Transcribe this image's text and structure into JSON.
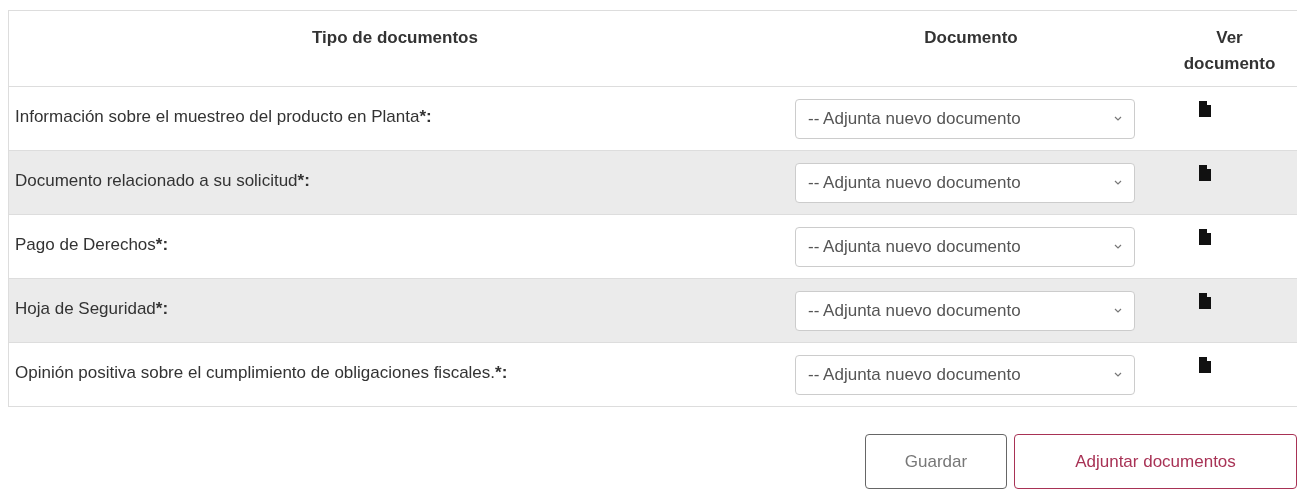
{
  "table": {
    "columns": [
      "Tipo de documentos",
      "Documento",
      "Ver documento"
    ],
    "rows": [
      {
        "label": "Información sobre el muestreo del producto en Planta***:**",
        "select": "-- Adjunta nuevo documento"
      },
      {
        "label": "Documento relacionado a su solicitud***:**",
        "select": "-- Adjunta nuevo documento"
      },
      {
        "label": "Pago de Derechos***:**",
        "select": "-- Adjunta nuevo documento"
      },
      {
        "label": "Hoja de Seguridad***:**",
        "select": "-- Adjunta nuevo documento"
      },
      {
        "label": "Opinión positiva sobre el cumplimiento de obligaciones fiscales.***:**",
        "select": "-- Adjunta nuevo documento"
      }
    ]
  },
  "buttons": [
    {
      "label": "Guardar",
      "kind": "secondary"
    },
    {
      "label": "Adjuntar documentos",
      "kind": "primary"
    }
  ]
}
